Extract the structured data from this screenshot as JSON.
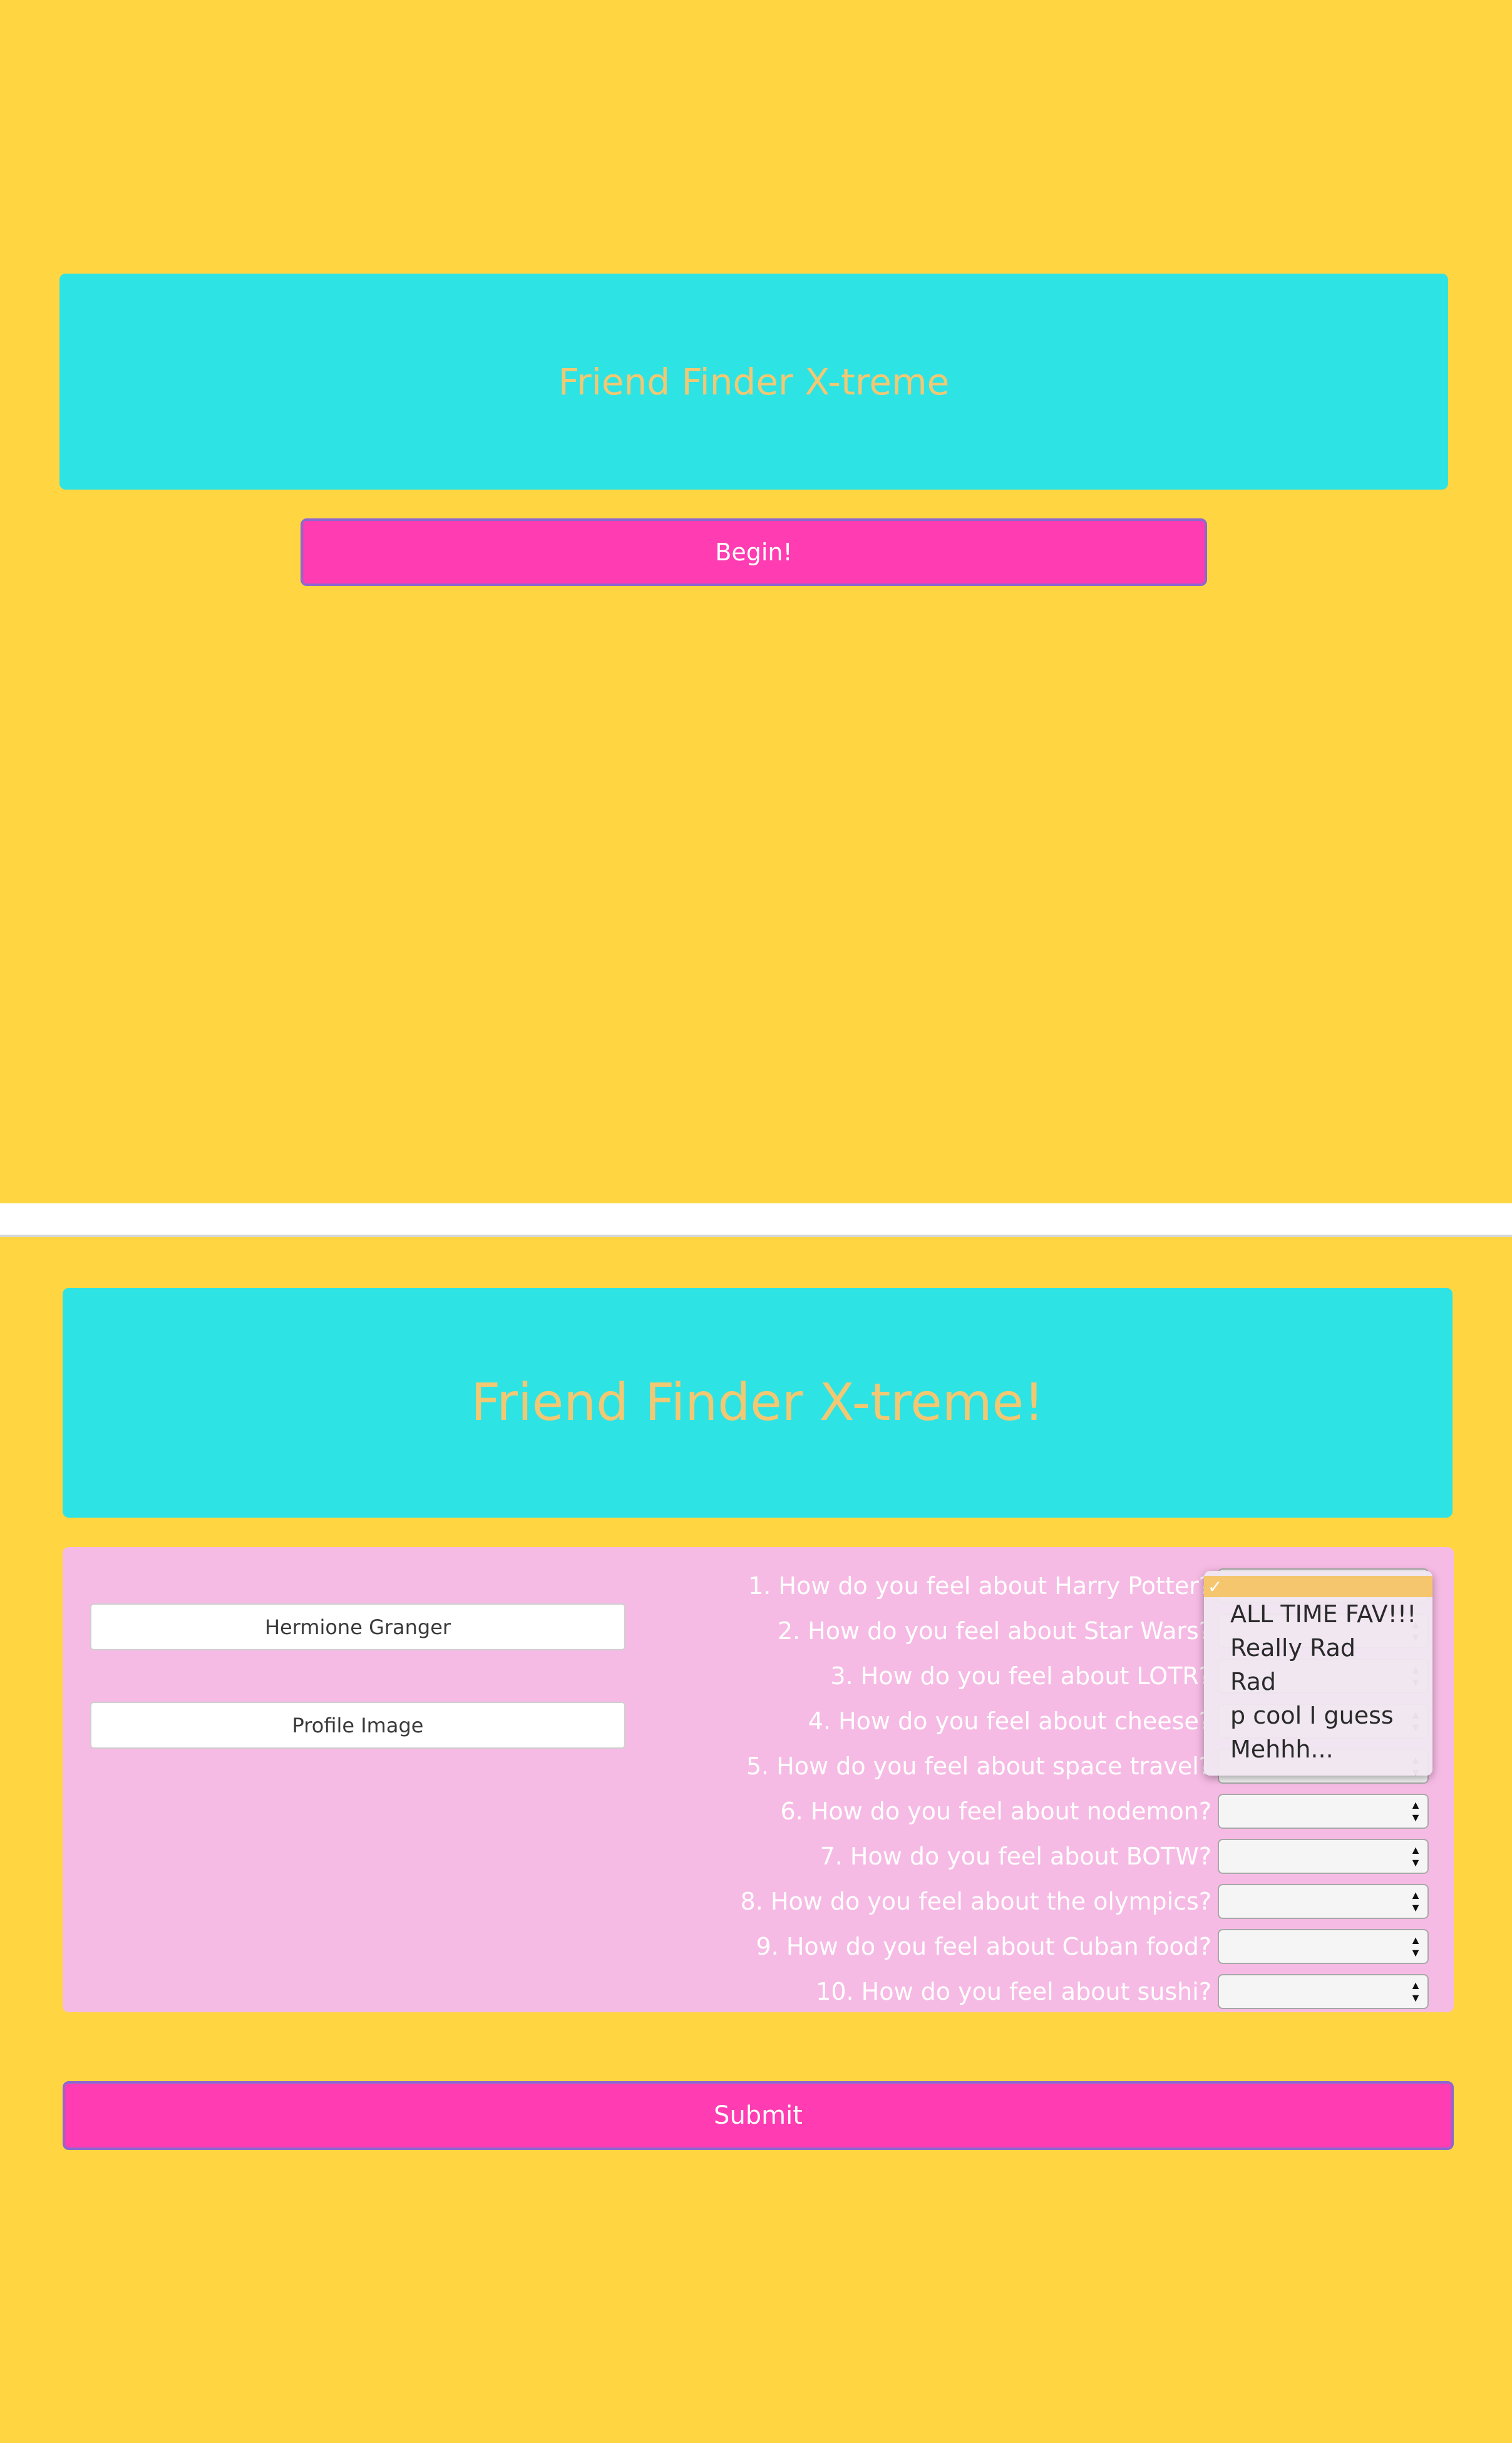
{
  "top_page": {
    "title": "Friend Finder X-treme",
    "begin_label": "Begin!"
  },
  "form_page": {
    "title": "Friend Finder X-treme!",
    "name_input_value": "Hermione Granger",
    "image_input_value": "Profile Image",
    "questions": [
      "1. How do you feel about Harry Potter?",
      "2. How do you feel about Star Wars?",
      "3. How do you feel about LOTR?",
      "4. How do you feel about cheese?",
      "5. How do you feel about space travel?",
      "6. How do you feel about nodemon?",
      "7. How do you feel about BOTW?",
      "8. How do you feel about the olympics?",
      "9. How do you feel about Cuban food?",
      "10. How do you feel about sushi?"
    ],
    "dropdown": {
      "selected_check": "✓",
      "options": [
        "ALL TIME FAV!!!",
        "Really Rad",
        "Rad",
        "p cool I guess",
        "Mehhh..."
      ]
    },
    "submit_label": "Submit"
  },
  "colors": {
    "background": "#ffd642",
    "jumbotron": "#2ee3e3",
    "title_text": "#f2c873",
    "button": "#ff3cb1",
    "form_card": "#f6bbe4"
  }
}
